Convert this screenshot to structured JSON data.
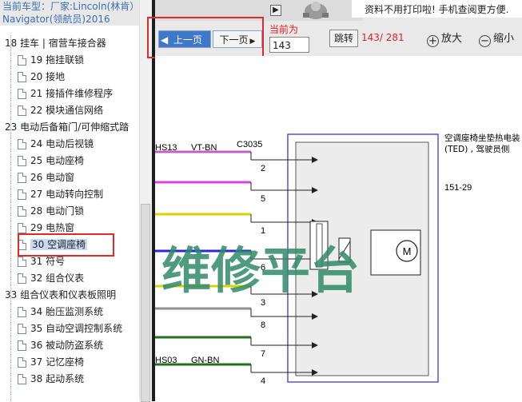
{
  "header": {
    "car_label": "当前车型：",
    "car_text": "厂家:Lincoln(林肯）Navigator(领航员)2016"
  },
  "tree": [
    {
      "type": "group",
      "text": "18 挂车 | 宿营车接合器"
    },
    {
      "type": "leaf",
      "text": "19 拖挂联锁"
    },
    {
      "type": "leaf",
      "text": "20 接地"
    },
    {
      "type": "leaf",
      "text": "21 接插件维修程序"
    },
    {
      "type": "leaf",
      "text": "22 模块通信网络"
    },
    {
      "type": "group",
      "text": "23 电动后备箱门/可伸缩式踏"
    },
    {
      "type": "leaf",
      "text": "24 电动后视镜"
    },
    {
      "type": "leaf",
      "text": "25 电动座椅"
    },
    {
      "type": "leaf",
      "text": "26 电动窗"
    },
    {
      "type": "leaf",
      "text": "27 电动转向控制"
    },
    {
      "type": "leaf",
      "text": "28 电动门锁"
    },
    {
      "type": "leaf",
      "text": "29 电热窗"
    },
    {
      "type": "leaf",
      "text": "30 空调座椅",
      "selected": true
    },
    {
      "type": "leaf",
      "text": "31 符号"
    },
    {
      "type": "leaf",
      "text": "32 组合仪表"
    },
    {
      "type": "group",
      "text": "33 组合仪表和仪表板照明"
    },
    {
      "type": "leaf",
      "text": "34 胎压监测系统"
    },
    {
      "type": "leaf",
      "text": "35 自动空调控制系统"
    },
    {
      "type": "leaf",
      "text": "36 被动防盗系统"
    },
    {
      "type": "leaf",
      "text": "37 记忆座椅"
    },
    {
      "type": "leaf",
      "text": "38 起动系统"
    }
  ],
  "toolbar": {
    "prev_label": "上一页",
    "next_label": "下一页",
    "current_label": "当前为",
    "page_input": "143",
    "jump_label": "跳转",
    "page_count": "143/ 281",
    "zoom_in_label": "放大",
    "zoom_out_label": "缩小",
    "ad_text": "资料不用打印啦! 手机查阅更方便."
  },
  "diagram": {
    "wire_top_code": "HS13",
    "wire_top_color": "VT-BN",
    "connector": "C3035",
    "wire_bottom_code": "HS03",
    "wire_bottom_color": "GN-BN",
    "pins": [
      "2",
      "5",
      "1",
      "6",
      "3",
      "8",
      "7",
      "4"
    ],
    "component_title": "空调座椅坐垫热电装",
    "component_sub": "(TED) , 驾驶员侧",
    "ref": "151-29",
    "watermark": "维修平台",
    "motor_label": "M"
  },
  "colors": {
    "selection_frame": "#e02a2a",
    "page_red": "#e02020",
    "box_blue": "#2a2ad6",
    "wire_violet": "#c060c0",
    "wire_magenta": "#e040e0",
    "wire_yellow": "#e0d000",
    "wire_gray": "#909090",
    "wire_green": "#207020",
    "watermark": "#2f8a6a"
  },
  "icons": [
    "doc-icon",
    "arrow-left-icon",
    "arrow-right-icon",
    "zoom-in-icon",
    "zoom-out-icon",
    "motor-icon",
    "mascot-icon"
  ]
}
